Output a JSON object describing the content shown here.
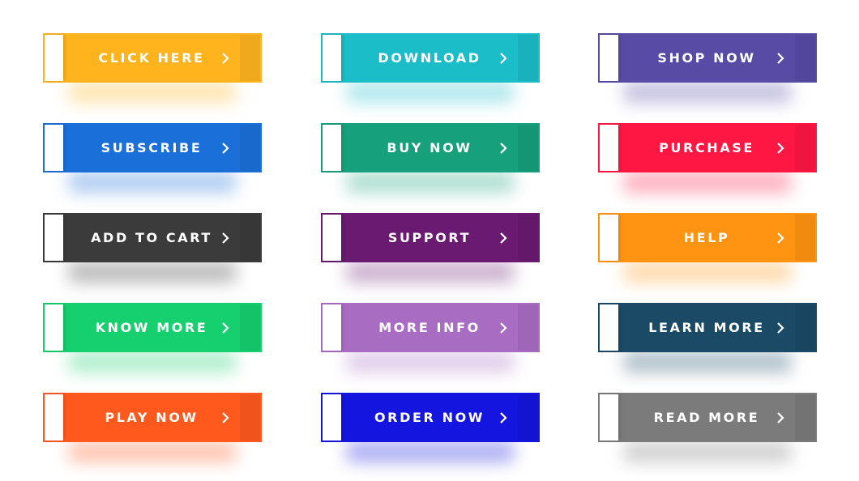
{
  "buttons": [
    {
      "label": "CLICK HERE",
      "color": "#FFB41E",
      "icon": "chevron-right-icon"
    },
    {
      "label": "DOWNLOAD",
      "color": "#1BBDC8",
      "icon": "chevron-right-icon"
    },
    {
      "label": "SHOP NOW",
      "color": "#574BA6",
      "icon": "chevron-right-icon"
    },
    {
      "label": "SUBSCRIBE",
      "color": "#1B6FD9",
      "icon": "chevron-right-icon"
    },
    {
      "label": "BUY NOW",
      "color": "#16A07C",
      "icon": "chevron-right-icon"
    },
    {
      "label": "PURCHASE",
      "color": "#FF1744",
      "icon": "chevron-right-icon"
    },
    {
      "label": "ADD TO CART",
      "color": "#3B3B3B",
      "icon": "chevron-right-icon"
    },
    {
      "label": "SUPPORT",
      "color": "#6A1A70",
      "icon": "chevron-right-icon"
    },
    {
      "label": "HELP",
      "color": "#FF9412",
      "icon": "chevron-right-icon"
    },
    {
      "label": "KNOW MORE",
      "color": "#16CF6E",
      "icon": "chevron-right-icon"
    },
    {
      "label": "MORE INFO",
      "color": "#A96CC3",
      "icon": "chevron-right-icon"
    },
    {
      "label": "LEARN MORE",
      "color": "#1B4A67",
      "icon": "chevron-right-icon"
    },
    {
      "label": "PLAY NOW",
      "color": "#FF591E",
      "icon": "chevron-right-icon"
    },
    {
      "label": "ORDER NOW",
      "color": "#1515E0",
      "icon": "chevron-right-icon"
    },
    {
      "label": "READ MORE",
      "color": "#7B7B7B",
      "icon": "chevron-right-icon"
    }
  ]
}
